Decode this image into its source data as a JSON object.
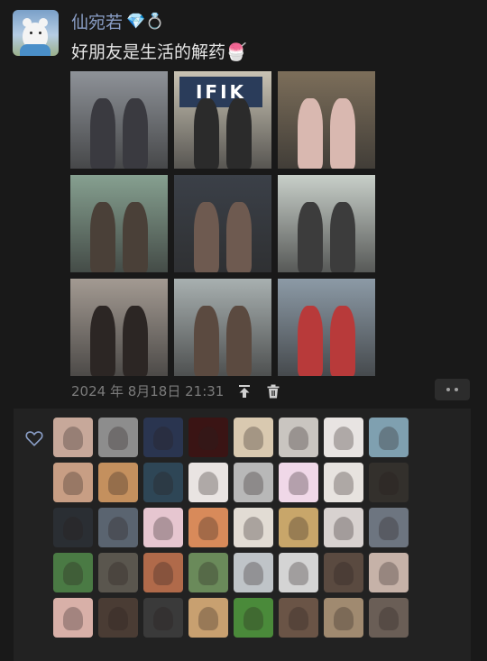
{
  "post": {
    "username": "仙宛若",
    "username_deco": "💎💍",
    "text": "好朋友是生活的解药🍧",
    "timestamp": "2024 年 8月18日 21:31"
  },
  "icons": {
    "pin": "pin-to-top-icon",
    "delete": "trash-icon",
    "more": "more-icon",
    "like": "heart-icon"
  },
  "photos": [
    {
      "bg": "#8e9298",
      "fig": "#3a3a40",
      "sign": ""
    },
    {
      "bg": "#c9c3b4",
      "fig": "#2b2b2b",
      "sign": "IFIK"
    },
    {
      "bg": "#7c6e5a",
      "fig": "#d9b8b0",
      "sign": ""
    },
    {
      "bg": "#86a090",
      "fig": "#4a4038",
      "sign": ""
    },
    {
      "bg": "#3b4048",
      "fig": "#6e5a50",
      "sign": ""
    },
    {
      "bg": "#c8cfc9",
      "fig": "#3c3c3c",
      "sign": ""
    },
    {
      "bg": "#a39a92",
      "fig": "#2c2624",
      "sign": ""
    },
    {
      "bg": "#a8b0b0",
      "fig": "#5b4a40",
      "sign": ""
    },
    {
      "bg": "#8c9aa6",
      "fig": "#b83a3a",
      "sign": ""
    }
  ],
  "likers": [
    "#c7a89a",
    "#8d8d8d",
    "#2a3550",
    "#3a1414",
    "#d9c9b0",
    "#c9c5c0",
    "#e8e4e2",
    "#7fa0b0",
    "#c89e84",
    "#c4905e",
    "#2e4656",
    "#e9e4e2",
    "#b8b8b8",
    "#f0d8e8",
    "#e7e3df",
    "#33302c",
    "#2a2e33",
    "#5a6470",
    "#e6c6d0",
    "#d88a5a",
    "#e2dcd4",
    "#c8a66a",
    "#d8d2d0",
    "#6d7580",
    "#4a7a44",
    "#5a564e",
    "#b06a4a",
    "#6a8a5a",
    "#bfc4c8",
    "#d4d4d4",
    "#5a4a40",
    "#c6b2a8",
    "#d8b0a8",
    "#4a3c34",
    "#3a3a3a",
    "#c8a070",
    "#4a8a3a",
    "#6a5446",
    "#a08a70",
    "#6a5e56"
  ]
}
